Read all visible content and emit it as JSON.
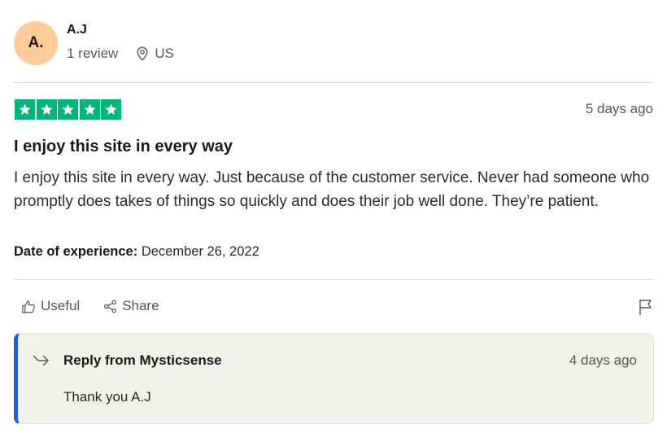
{
  "reviewer": {
    "initials": "A.",
    "name": "A.J",
    "review_count": "1 review",
    "location": "US",
    "avatar_color": "#ffcc99"
  },
  "review": {
    "rating": 5,
    "rating_color": "#00b67a",
    "posted": "5 days ago",
    "title": "I enjoy this site in every way",
    "body": "I enjoy this site in every way. Just because of the customer service. Never had someone who promptly does takes of things so quickly and does their job well done. They’re patient.",
    "experience_label": "Date of experience:",
    "experience_date": "December 26, 2022"
  },
  "actions": {
    "useful": "Useful",
    "share": "Share",
    "flag_icon": "flag-icon"
  },
  "reply": {
    "from": "Reply from Mysticsense",
    "posted": "4 days ago",
    "text": "Thank you A.J",
    "accent_color": "#1c5fe5"
  }
}
